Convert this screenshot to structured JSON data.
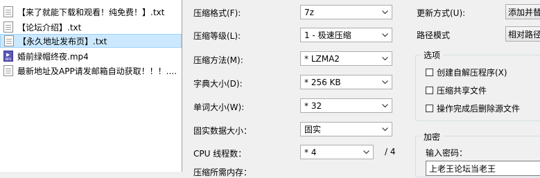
{
  "file_list": [
    {
      "name": "【来了就能下载和观看！纯免费！】.txt",
      "type": "txt",
      "selected": false
    },
    {
      "name": "【论坛介绍】.txt",
      "type": "txt",
      "selected": false
    },
    {
      "name": "【永久地址发布页】.txt",
      "type": "txt",
      "selected": true
    },
    {
      "name": "婚前绿帽终夜.mp4",
      "type": "video",
      "selected": false
    },
    {
      "name": "最新地址及APP请发邮箱自动获取！！！....",
      "type": "txt",
      "selected": false
    }
  ],
  "settings": {
    "format_label": "压缩格式(F):",
    "format_value": "7z",
    "level_label": "压缩等级(L):",
    "level_value": "1 - 极速压缩",
    "method_label": "压缩方法(M):",
    "method_value": "* LZMA2",
    "dict_label": "字典大小(D):",
    "dict_value": "* 256 KB",
    "word_label": "单词大小(W):",
    "word_value": "* 32",
    "solid_label": "固实数据大小：",
    "solid_value": "固实",
    "cpu_label": "CPU 线程数：",
    "cpu_value": "* 4",
    "cpu_total": "/ 4",
    "memory_label": "压缩所需内存："
  },
  "right": {
    "update_label": "更新方式(U):",
    "update_value": "添加并替",
    "path_label": "路径模式",
    "path_value": "相对路径",
    "options_title": "选项",
    "opt_sfx": "创建自解压程序(X)",
    "opt_shared": "压缩共享文件",
    "opt_delete": "操作完成后删除源文件",
    "encryption_title": "加密",
    "password_label": "输入密码：",
    "password_value": "上老王论坛当老王"
  }
}
